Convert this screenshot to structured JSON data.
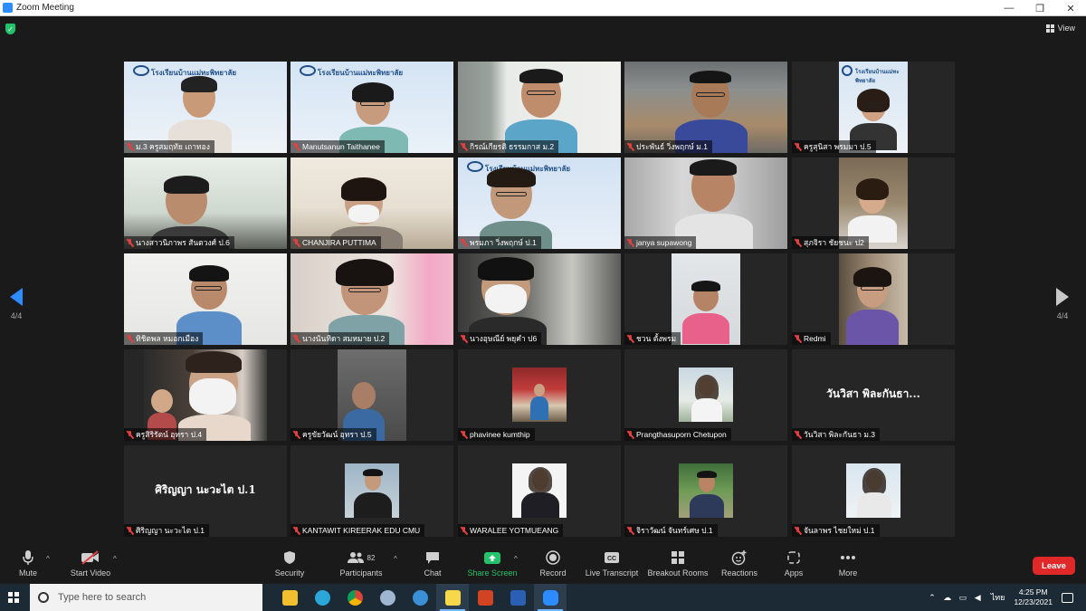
{
  "window": {
    "title": "Zoom Meeting",
    "controls": [
      "—",
      "❐",
      "✕"
    ]
  },
  "view_button": {
    "label": "View"
  },
  "pagination": {
    "left_page": "4/4",
    "right_page": "4/4"
  },
  "participants": [
    "ม.3 ครูสมฤทัย เถาทอง",
    "Manutsanun Taithanee",
    "กิรณ์เกียรติ ธรรมกาส ม.2",
    "ประพันธ์ วิ่งพฤกษ์ ม.1",
    "ครูสุนิสา พรมมา ป.5",
    "นางสาวนิภาพร สันตวงศ์ ป.6",
    "CHANJIRA PUTTIMA",
    "พรมภา วิ่งพฤกษ์ ป.1",
    "janya supawong",
    "สุภจิรา ชัยชนะ ป2",
    "ทิชิตพล หมอกเมือง",
    "นางนันทิดา สมหมาย ป.2",
    "นางอุษณีย์ พยุคำ ป6",
    "ชวน ตั้งพรม",
    "Redmi",
    "ครูสิริรัตน์ อุทรา ป.4",
    "ครูขัยวัฒน์ อุทรา ป.5",
    "phavinee kumthip",
    "Prangthasuporn Chetupon",
    "วันวิสา พิละกันธา ม.3",
    "ศิริญญา นะวะไต ป.1",
    "KANTAWIT KIREERAK EDU CMU",
    "WARALEE YOTMUEANG",
    "จิราวัฒน์ จันทร์เศษ ป.1",
    "จันลาพร ไชยใหม่ ป.1"
  ],
  "tile_big_names": {
    "t19": "วันวิสา พิละกันธา...",
    "t20": "ศิริญญา นะวะไต ป.1"
  },
  "banner_text": "โรงเรียนบ้านแม่ทะพิทยาลัย",
  "toolbar": {
    "mute": "Mute",
    "start_video": "Start Video",
    "security": "Security",
    "participants": "Participants",
    "participants_count": "82",
    "chat": "Chat",
    "share_screen": "Share Screen",
    "record": "Record",
    "live_transcript": "Live Transcript",
    "breakout_rooms": "Breakout Rooms",
    "reactions": "Reactions",
    "apps": "Apps",
    "more": "More",
    "leave": "Leave",
    "colors": {
      "accent": "#2d8cff",
      "share": "#23c26b",
      "leave": "#e02828",
      "muted": "#e0403f"
    }
  },
  "taskbar": {
    "search_placeholder": "Type here to search",
    "time": "4:25 PM",
    "date": "12/23/2021",
    "language": "ไทย",
    "apps": [
      "file-explorer",
      "edge",
      "chrome",
      "app-blue",
      "internet-explorer",
      "sticky-notes",
      "powerpoint",
      "word",
      "zoom"
    ]
  }
}
